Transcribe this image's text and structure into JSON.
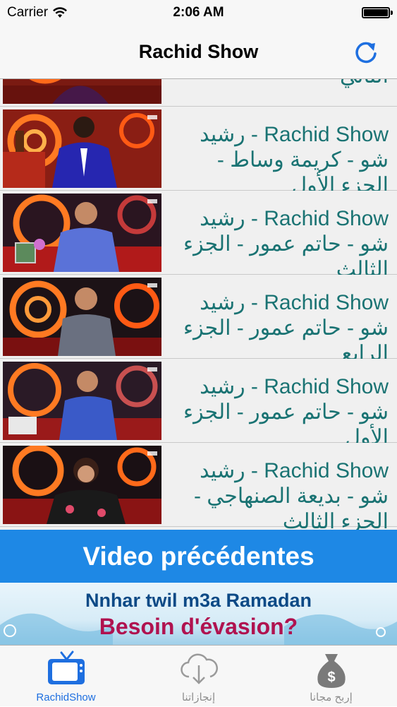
{
  "status": {
    "carrier": "Carrier",
    "time": "2:06 AM"
  },
  "nav": {
    "title": "Rachid Show",
    "refresh_icon": "refresh-icon"
  },
  "partial_row": {
    "title": "- كريمة وساط - الجزء الثاني"
  },
  "rows": [
    {
      "title": "Rachid Show - رشيد شو - كريمة وساط - الجزء الأول"
    },
    {
      "title": "Rachid Show - رشيد شو - حاتم عمور - الجزء الثالث"
    },
    {
      "title": "Rachid Show - رشيد شو - حاتم عمور - الجزء الرابع"
    },
    {
      "title": "Rachid Show - رشيد شو - حاتم عمور - الجزء الأول"
    },
    {
      "title": "Rachid Show - رشيد شو - بديعة الصنهاجي - الجزء الثالث"
    }
  ],
  "banner": {
    "label": "Video précédentes"
  },
  "ad": {
    "line1": "Nnhar twil m3a Ramadan",
    "line2": "Besoin d'évasion?"
  },
  "tabs": [
    {
      "label": "RachidShow",
      "icon": "tv-icon",
      "active": true
    },
    {
      "label": "إنجازاتنا",
      "icon": "cloud-download-icon",
      "active": false
    },
    {
      "label": "إربح مجانا",
      "icon": "money-bag-icon",
      "active": false
    }
  ],
  "colors": {
    "accent": "#1e6fe0",
    "title_text": "#1a7373",
    "banner": "#1e88e5"
  }
}
